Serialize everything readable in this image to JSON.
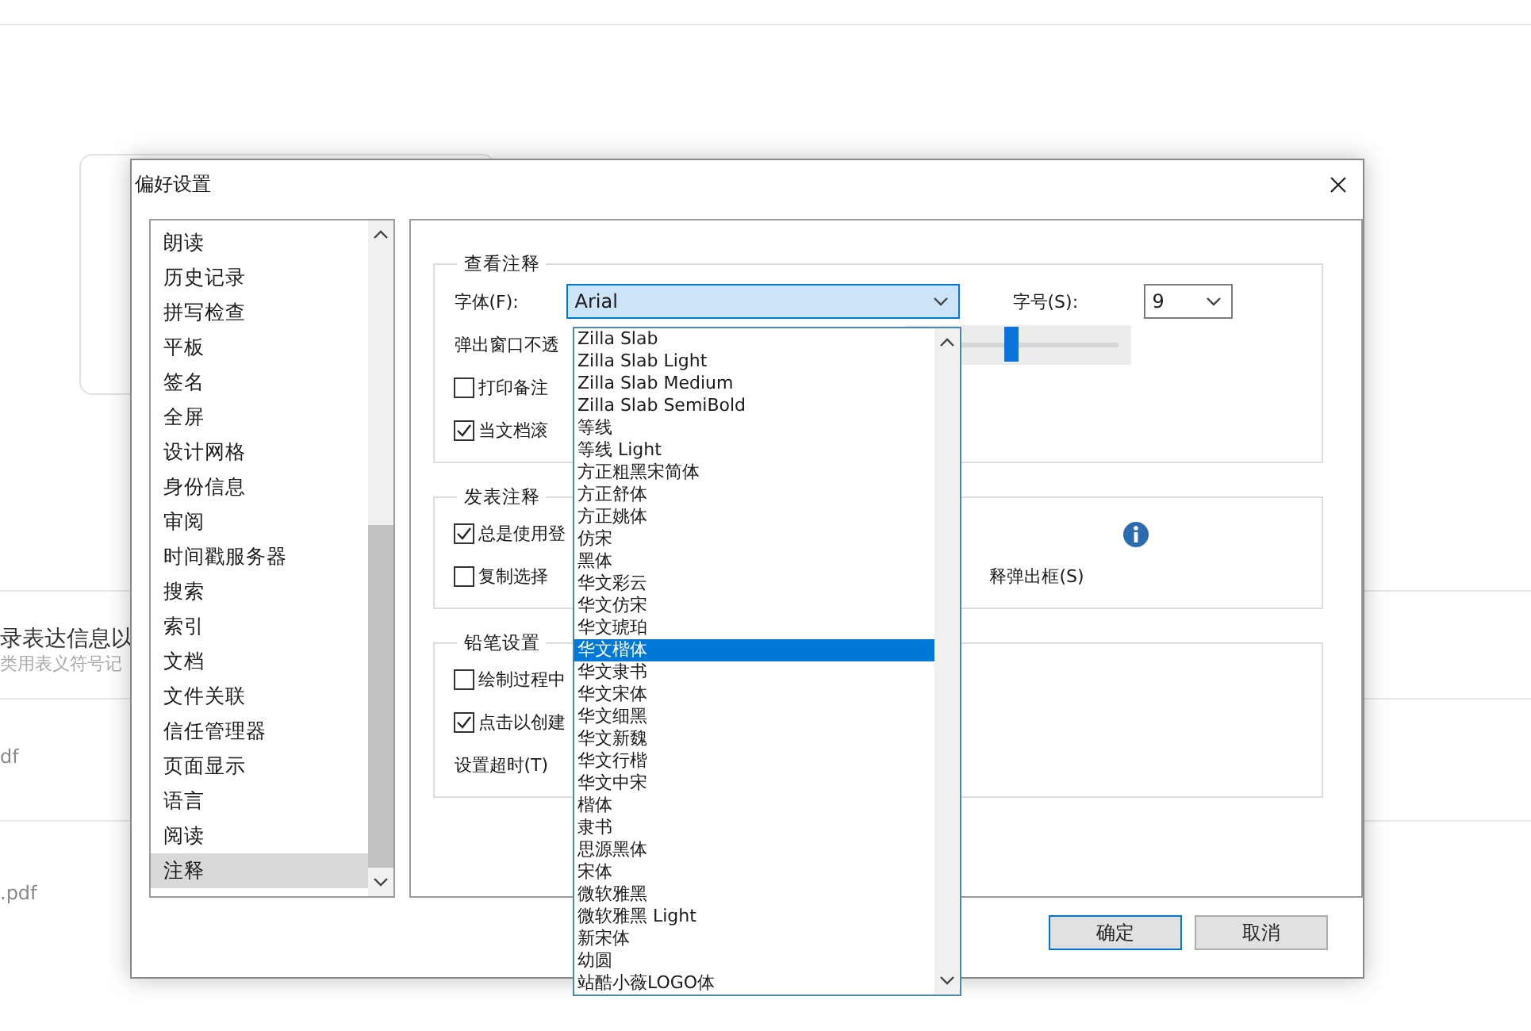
{
  "background": {
    "texts": [
      {
        "text": "录表达信息以",
        "kind": "title"
      },
      {
        "text": "类用表义符号记",
        "kind": "sub"
      },
      {
        "text": "df",
        "kind": "file"
      },
      {
        "text": ".pdf",
        "kind": "file"
      }
    ]
  },
  "dialog": {
    "title": "偏好设置",
    "categories": [
      {
        "label": "朗读",
        "selected": false
      },
      {
        "label": "历史记录",
        "selected": false
      },
      {
        "label": "拼写检查",
        "selected": false
      },
      {
        "label": "平板",
        "selected": false
      },
      {
        "label": "签名",
        "selected": false
      },
      {
        "label": "全屏",
        "selected": false
      },
      {
        "label": "设计网格",
        "selected": false
      },
      {
        "label": "身份信息",
        "selected": false
      },
      {
        "label": "审阅",
        "selected": false
      },
      {
        "label": "时间戳服务器",
        "selected": false
      },
      {
        "label": "搜索",
        "selected": false
      },
      {
        "label": "索引",
        "selected": false
      },
      {
        "label": "文档",
        "selected": false
      },
      {
        "label": "文件关联",
        "selected": false
      },
      {
        "label": "信任管理器",
        "selected": false
      },
      {
        "label": "页面显示",
        "selected": false
      },
      {
        "label": "语言",
        "selected": false
      },
      {
        "label": "阅读",
        "selected": false
      },
      {
        "label": "注释",
        "selected": true
      }
    ],
    "sections": [
      {
        "title": "查看注释",
        "rows": [
          {
            "kind": "fonts",
            "label": "字体(F):",
            "value": "Arial",
            "size_label": "字号(S):",
            "size_value": "9"
          },
          {
            "kind": "slider",
            "label": "弹出窗口不透",
            "level": 0.46
          },
          {
            "kind": "checkbox",
            "label": "打印备注",
            "checked": false
          },
          {
            "kind": "checkbox",
            "label": "当文档滚",
            "checked": true
          }
        ]
      },
      {
        "title": "发表注释",
        "rows": [
          {
            "kind": "checkbox",
            "label": "总是使用登",
            "checked": true,
            "info": true
          },
          {
            "kind": "checkbox",
            "label": "复制选择",
            "checked": false,
            "trailing": "释弹出框(S)"
          }
        ]
      },
      {
        "title": "铅笔设置",
        "rows": [
          {
            "kind": "checkbox",
            "label": "绘制过程中",
            "checked": false
          },
          {
            "kind": "checkbox",
            "label": "点击以创建",
            "checked": true
          },
          {
            "kind": "text",
            "label": "设置超时(T)"
          }
        ]
      }
    ],
    "buttons": [
      {
        "label": "确定",
        "default": true
      },
      {
        "label": "取消",
        "default": false
      }
    ]
  },
  "font_list": {
    "items": [
      {
        "label": "Zilla Slab",
        "selected": false
      },
      {
        "label": "Zilla Slab Light",
        "selected": false
      },
      {
        "label": "Zilla Slab Medium",
        "selected": false
      },
      {
        "label": "Zilla Slab SemiBold",
        "selected": false
      },
      {
        "label": "等线",
        "selected": false
      },
      {
        "label": "等线 Light",
        "selected": false
      },
      {
        "label": "方正粗黑宋简体",
        "selected": false
      },
      {
        "label": "方正舒体",
        "selected": false
      },
      {
        "label": "方正姚体",
        "selected": false
      },
      {
        "label": "仿宋",
        "selected": false
      },
      {
        "label": "黑体",
        "selected": false
      },
      {
        "label": "华文彩云",
        "selected": false
      },
      {
        "label": "华文仿宋",
        "selected": false
      },
      {
        "label": "华文琥珀",
        "selected": false
      },
      {
        "label": "华文楷体",
        "selected": true
      },
      {
        "label": "华文隶书",
        "selected": false
      },
      {
        "label": "华文宋体",
        "selected": false
      },
      {
        "label": "华文细黑",
        "selected": false
      },
      {
        "label": "华文新魏",
        "selected": false
      },
      {
        "label": "华文行楷",
        "selected": false
      },
      {
        "label": "华文中宋",
        "selected": false
      },
      {
        "label": "楷体",
        "selected": false
      },
      {
        "label": "隶书",
        "selected": false
      },
      {
        "label": "思源黑体",
        "selected": false
      },
      {
        "label": "宋体",
        "selected": false
      },
      {
        "label": "微软雅黑",
        "selected": false
      },
      {
        "label": "微软雅黑 Light",
        "selected": false
      },
      {
        "label": "新宋体",
        "selected": false
      },
      {
        "label": "幼圆",
        "selected": false
      },
      {
        "label": "站酷小薇LOGO体",
        "selected": false
      }
    ]
  }
}
